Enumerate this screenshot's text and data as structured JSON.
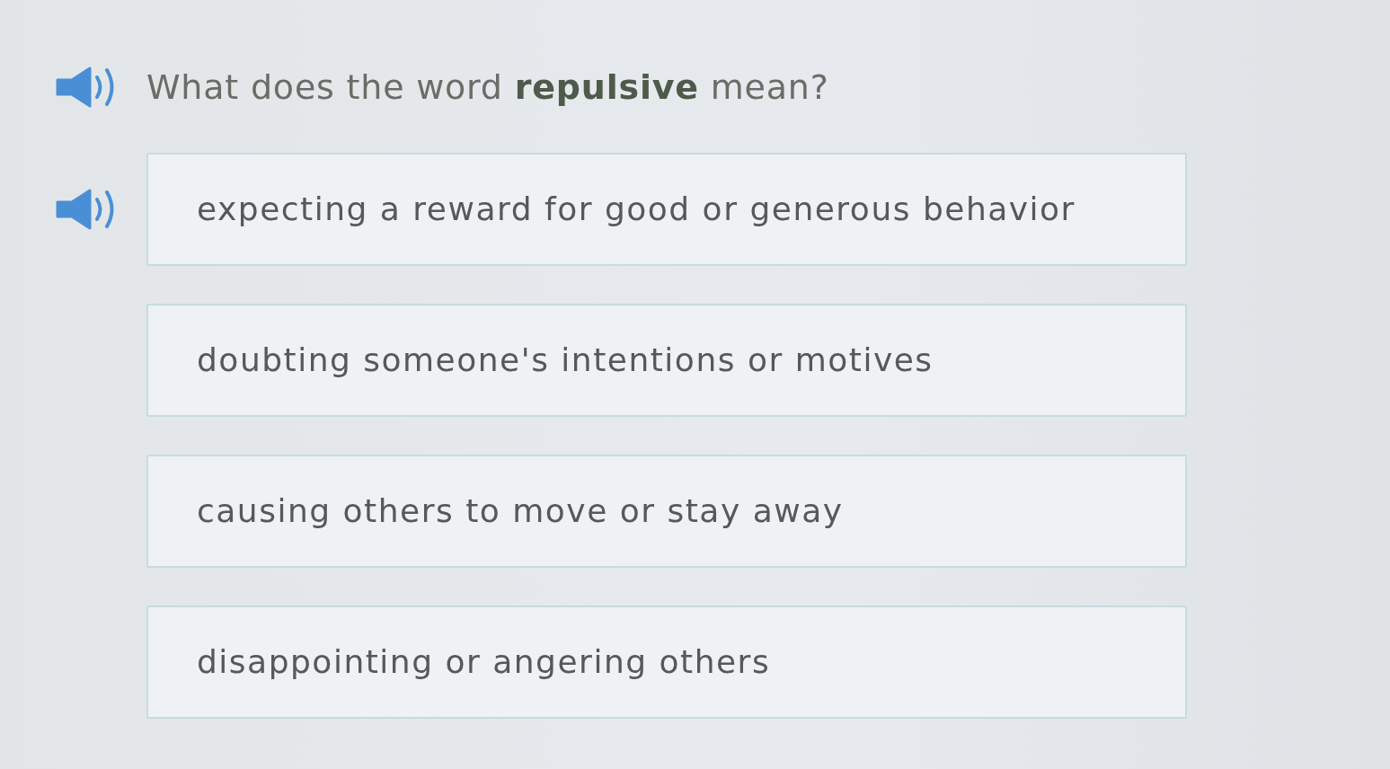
{
  "question": {
    "text": "What does the word **repulsive** mean?",
    "audio_button": true
  },
  "choices": [
    {
      "text": "expecting a reward for good or generous behavior",
      "audio_button": true
    },
    {
      "text": "doubting someone's intentions or motives",
      "audio_button": false
    },
    {
      "text": "causing others to move or stay away",
      "audio_button": false
    },
    {
      "text": "disappointing or angering others",
      "audio_button": false
    }
  ]
}
